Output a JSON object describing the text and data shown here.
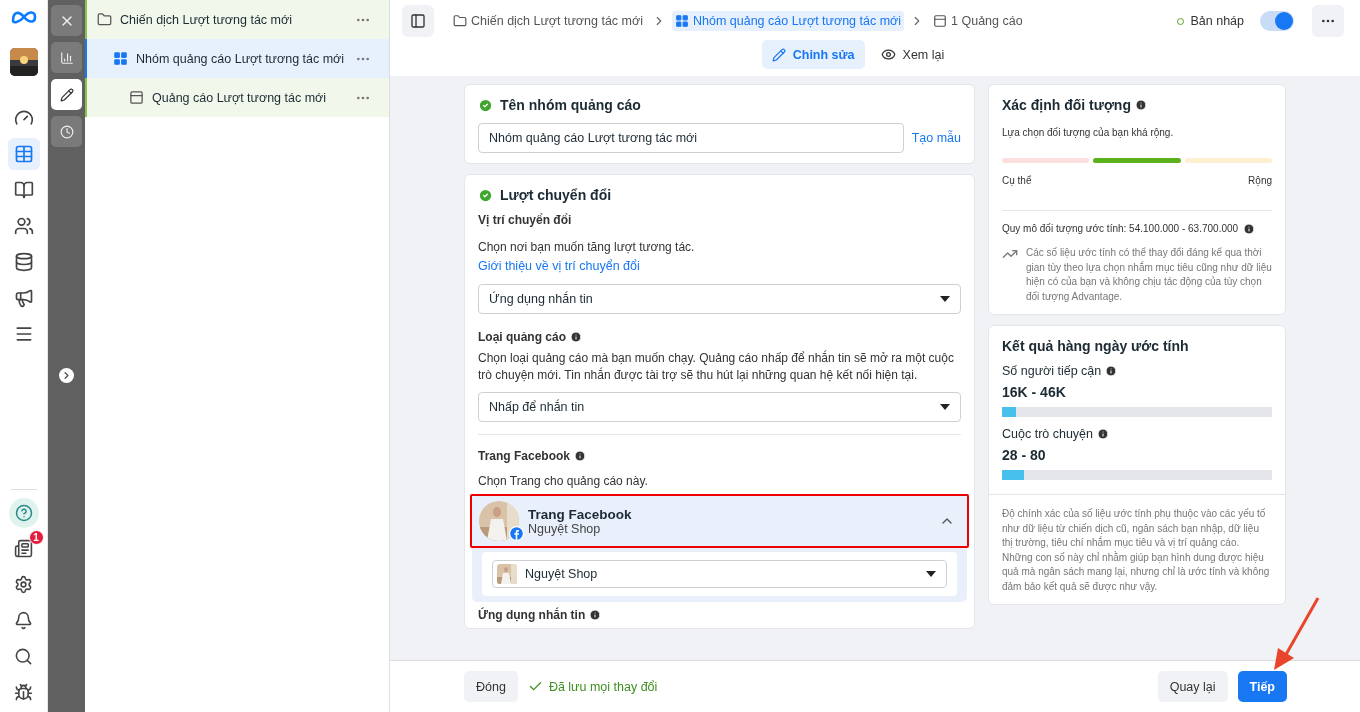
{
  "nav_rail": {
    "notification_badge": "1"
  },
  "tree": [
    {
      "kind": "campaign",
      "label": "Chiến dịch Lượt tương tác mới",
      "selected": false
    },
    {
      "kind": "adset",
      "label": "Nhóm quảng cáo Lượt tương tác mới",
      "selected": true
    },
    {
      "kind": "ad",
      "label": "Quảng cáo Lượt tương tác mới",
      "selected": false
    }
  ],
  "tool_column": [
    {
      "kind": "close",
      "selected": false
    },
    {
      "kind": "chart",
      "selected": false
    },
    {
      "kind": "edit",
      "selected": true
    },
    {
      "kind": "history",
      "selected": false
    }
  ],
  "breadcrumb": [
    {
      "kind": "campaign",
      "label": "Chiến dịch Lượt tương tác mới",
      "selected": false
    },
    {
      "kind": "adset",
      "label": "Nhóm quảng cáo Lượt tương tác mới",
      "selected": true
    },
    {
      "kind": "ad",
      "label": "1 Quảng cáo",
      "selected": false
    }
  ],
  "status": {
    "label": "Bản nháp",
    "toggle_on": true
  },
  "mode_tabs": [
    {
      "kind": "edit",
      "label": "Chỉnh sửa",
      "selected": true
    },
    {
      "kind": "review",
      "label": "Xem lại",
      "selected": false
    }
  ],
  "name_card": {
    "title": "Tên nhóm quảng cáo",
    "value": "Nhóm quảng cáo Lượt tương tác mới",
    "link": "Tạo mẫu"
  },
  "conversion_card": {
    "title": "Lượt chuyển đổi",
    "location": {
      "heading": "Vị trí chuyển đổi",
      "text": "Chọn nơi bạn muốn tăng lượt tương tác.",
      "link": "Giới thiệu về vị trí chuyển đổi",
      "value": "Ứng dụng nhắn tin"
    },
    "ad_type": {
      "heading": "Loại quảng cáo",
      "text": "Chọn loại quảng cáo mà bạn muốn chạy. Quảng cáo nhấp để nhắn tin sẽ mở ra một cuộc trò chuyện mới. Tin nhắn được tài trợ sẽ thu hút lại những quan hệ kết nối hiện tại.",
      "value": "Nhấp để nhắn tin"
    },
    "page": {
      "heading": "Trang Facebook",
      "text": "Chọn Trang cho quảng cáo này.",
      "title": "Trang Facebook",
      "name": "Nguyệt Shop",
      "expanded": true,
      "value": "Nguyệt Shop"
    },
    "next_heading": "Ứng dụng nhắn tin"
  },
  "audience_card": {
    "title": "Xác định đối tượng",
    "text": "Lựa chọn đối tượng của bạn khá rộng.",
    "left": "Cụ thể",
    "right": "Rộng",
    "segments": [
      {
        "selected": false
      },
      {
        "selected": true
      },
      {
        "selected": false
      }
    ],
    "size": "Quy mô đối tượng ước tính: 54.100.000 - 63.700.000",
    "note": "Các số liệu ước tính có thể thay đổi đáng kể qua thời gian tùy theo lựa chọn nhắm mục tiêu cũng như dữ liệu hiện có của bạn và không chịu tác động của tùy chọn đối tượng Advantage."
  },
  "results_card": {
    "title": "Kết quả hàng ngày ước tính",
    "metrics": [
      {
        "label": "Số người tiếp cận",
        "value": "16K - 46K",
        "level": 0.05
      },
      {
        "label": "Cuộc trò chuyện",
        "value": "28 - 80",
        "level": 0.08
      }
    ],
    "note": "Độ chính xác của số liệu ước tính phụ thuộc vào các yếu tố như dữ liệu từ chiến dịch cũ, ngân sách bạn nhập, dữ liệu thị trường, tiêu chí nhắm mục tiêu và vị trí quảng cáo. Những con số này chỉ nhằm giúp bạn hình dung được hiệu quả mà ngân sách mang lại, nhưng chỉ là ước tính và không đảm bảo kết quả sẽ được như vậy."
  },
  "footer": {
    "close": "Đóng",
    "saved": "Đã lưu mọi thay đổi",
    "back": "Quay lại",
    "next": "Tiếp"
  }
}
